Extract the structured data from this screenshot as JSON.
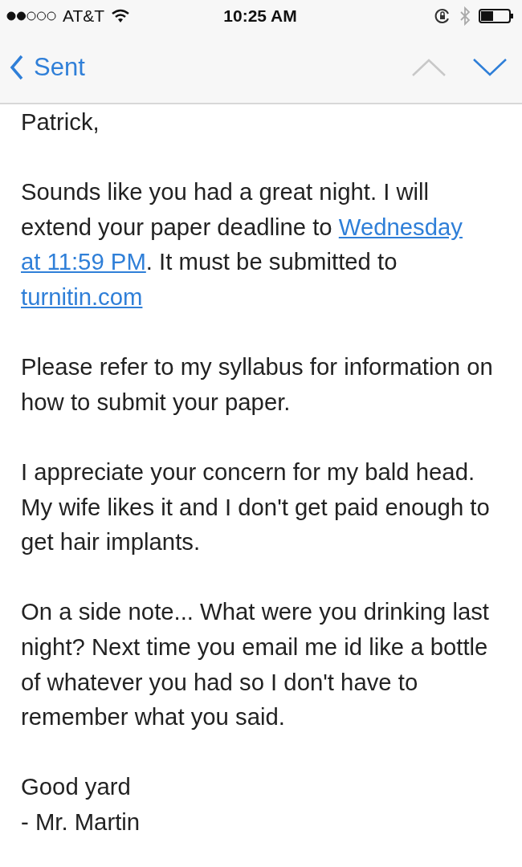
{
  "status_bar": {
    "carrier": "AT&T",
    "time": "10:25 AM"
  },
  "nav": {
    "back_label": "Sent",
    "previous": {
      "disabled": true
    },
    "next": {
      "disabled": false
    }
  },
  "body": {
    "paragraphs": [
      {
        "segments": [
          {
            "kind": "text",
            "text": "Patrick,"
          }
        ]
      },
      {
        "segments": [
          {
            "kind": "text",
            "text": "Sounds like you had a great night. I will extend your paper deadline to "
          },
          {
            "kind": "link",
            "text": "Wednesday"
          },
          {
            "kind": "space"
          },
          {
            "kind": "link",
            "text": "at 11:59 PM"
          },
          {
            "kind": "text",
            "text": ". It must be submitted to "
          },
          {
            "kind": "link",
            "text": "turnitin.com"
          }
        ]
      },
      {
        "segments": [
          {
            "kind": "text",
            "text": "Please refer to my syllabus for information on how to submit your paper."
          }
        ]
      },
      {
        "segments": [
          {
            "kind": "text",
            "text": "I appreciate your concern for my bald head. My wife likes it and I don't get paid enough to get hair implants."
          }
        ]
      },
      {
        "segments": [
          {
            "kind": "text",
            "text": "On a side note... What were you drinking last night? Next time you email me id like a bottle of whatever you had so I don't have to remember what you said."
          }
        ]
      },
      {
        "segments": [
          {
            "kind": "text",
            "text": "Good yard"
          }
        ]
      },
      {
        "segments": [
          {
            "kind": "text",
            "text": "- Mr. Martin"
          }
        ]
      }
    ]
  }
}
